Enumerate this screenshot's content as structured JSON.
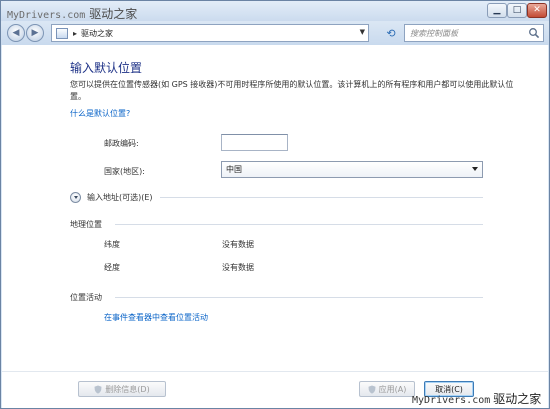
{
  "watermark": {
    "site": "MyDrivers.com",
    "cn": "驱动之家"
  },
  "titlebar": {
    "buttons": {
      "minimize_icon": "minimize-icon",
      "maximize_icon": "maximize-icon",
      "close_icon": "close-icon"
    }
  },
  "navbar": {
    "path": "驱动之家",
    "search_placeholder": "搜索控制面板"
  },
  "page": {
    "heading": "输入默认位置",
    "description": "您可以提供在位置传感器(如 GPS 接收器)不可用时程序所使用的默认位置。该计算机上的所有程序和用户都可以使用此默认位置。",
    "what_link": "什么是默认位置?",
    "zip_label": "邮政编码:",
    "zip_value": "",
    "country_label": "国家(地区):",
    "country_value": "中国",
    "optional_address": "输入地址(可选)(E)",
    "geo_section": "地理位置",
    "latitude_label": "纬度",
    "latitude_value": "没有数据",
    "longitude_label": "经度",
    "longitude_value": "没有数据",
    "activity_section": "位置活动",
    "event_link": "在事件查看器中查看位置活动"
  },
  "footer": {
    "clear_label": "删除信息(D)",
    "apply_label": "应用(A)",
    "cancel_label": "取消(C)"
  },
  "colors": {
    "heading": "#1e3287",
    "link": "#0a64c8",
    "frame": "#d9e6f4"
  }
}
